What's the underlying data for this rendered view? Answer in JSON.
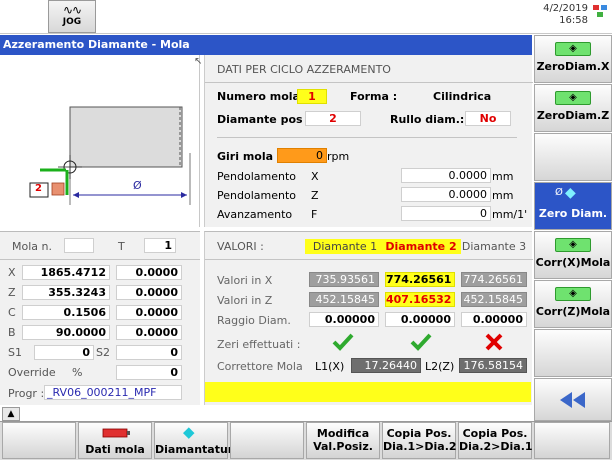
{
  "topbar": {
    "mode": "JOG",
    "date": "4/2/2019",
    "time": "16:58"
  },
  "title": "Azzeramento Diamante - Mola",
  "colors": {
    "accent": "#2c55c7",
    "highlight": "#ffff1a",
    "orange": "#ff9a1a",
    "ok": "#2faa2f",
    "error": "#e00000"
  },
  "softkeys_right": [
    {
      "label": "ZeroDiam.X",
      "icon": "zero-icon"
    },
    {
      "label": "ZeroDiam.Z",
      "icon": "zero-icon"
    },
    {
      "label": ""
    },
    {
      "label": "Zero Diam.",
      "icon": "diamond-icon",
      "icon_text": "Ø"
    },
    {
      "label": "Corr(X)Mola",
      "icon": "zero-icon"
    },
    {
      "label": "Corr(Z)Mola",
      "icon": "zero-icon"
    },
    {
      "label": ""
    },
    {
      "label": "",
      "icon": "double-left-arrow-icon"
    }
  ],
  "diagram": {
    "wheel_number": "2",
    "diameter_symbol": "Ø"
  },
  "ciclo": {
    "title": "DATI PER CICLO AZZERAMENTO",
    "numero_mola_label": "Numero mola :",
    "numero_mola": "1",
    "forma_label": "Forma :",
    "forma": "Cilindrica",
    "diamante_pos_label": "Diamante pos :",
    "diamante_pos": "2",
    "rullo_label": "Rullo diam.:",
    "rullo": "No",
    "giri_label": "Giri mola",
    "giri_value": "0",
    "giri_unit": "rpm",
    "pend_label": "Pendolamento",
    "pend_x_axis": "X",
    "pend_x_value": "0.0000",
    "pend_x_unit": "mm",
    "pend_z_axis": "Z",
    "pend_z_value": "0.0000",
    "pend_z_unit": "mm",
    "avanz_label": "Avanzamento",
    "avanz_axis": "F",
    "avanz_value": "0",
    "avanz_unit": "mm/1'"
  },
  "left": {
    "mola_label": "Mola n.",
    "mola_value": "",
    "t_label": "T",
    "t_value": "1",
    "axes": [
      {
        "name": "X",
        "value": "1865.4712",
        "extra": "0.0000"
      },
      {
        "name": "Z",
        "value": "355.3243",
        "extra": "0.0000"
      },
      {
        "name": "C",
        "value": "0.1506",
        "extra": "0.0000"
      },
      {
        "name": "B",
        "value": "90.0000",
        "extra": "0.0000"
      }
    ],
    "s1_label": "S1",
    "s1_value": "0",
    "s2_label": "S2",
    "s2_value": "0",
    "override_label": "Override",
    "override_unit": "%",
    "override_value": "0",
    "progr_label": "Progr :",
    "progr_value": "_RV06_000211_MPF"
  },
  "valori": {
    "title": "VALORI :",
    "diamante1": "Diamante 1",
    "diamante2": "Diamante 2",
    "diamante3": "Diamante 3",
    "valori_x_label": "Valori in X",
    "valori_x": [
      "735.93561",
      "774.26561",
      "774.26561"
    ],
    "valori_z_label": "Valori in Z",
    "valori_z": [
      "452.15845",
      "407.16532",
      "452.15845"
    ],
    "raggio_label": "Raggio Diam.",
    "raggio": [
      "0.00000",
      "0.00000",
      "0.00000"
    ],
    "zeri_label": "Zeri effettuati :",
    "zeri": [
      "ok",
      "ok",
      "error"
    ],
    "corr_label": "Correttore Mola",
    "l1_label": "L1(X)",
    "l1_value": "17.26440",
    "l2_label": "L2(Z)",
    "l2_value": "176.58154"
  },
  "bottom_softkeys": [
    {
      "label": ""
    },
    {
      "label": "Dati mola",
      "icon": "wheel-icon"
    },
    {
      "label": "Diamantatura",
      "icon": "diamond-icon"
    },
    {
      "label": ""
    },
    {
      "label": "Modifica Val.Posiz.",
      "line1": "Modifica",
      "line2": "Val.Posiz."
    },
    {
      "label": "Copia Pos. Dia.1>Dia.2",
      "line1": "Copia Pos.",
      "line2": "Dia.1>Dia.2"
    },
    {
      "label": "Copia Pos. Dia.2>Dia.1",
      "line1": "Copia Pos.",
      "line2": "Dia.2>Dia.1"
    },
    {
      "label": ""
    }
  ]
}
